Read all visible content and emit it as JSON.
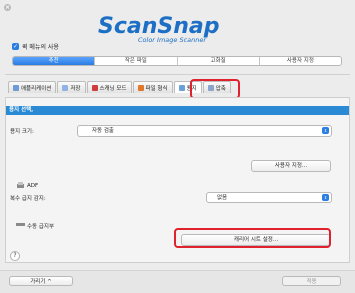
{
  "window": {
    "close_glyph": "×"
  },
  "logo": {
    "brand": "ScanSnap",
    "subtitle": "Color Image Scanner"
  },
  "quick_menu": {
    "checked": true,
    "label": "퀵 메뉴의 사용"
  },
  "profiles": [
    {
      "label": "추천",
      "active": true
    },
    {
      "label": "작은 파일",
      "active": false
    },
    {
      "label": "고화질",
      "active": false
    },
    {
      "label": "사용자 지정",
      "active": false
    }
  ],
  "tabs": [
    {
      "label": "애플리케이션",
      "icon": "application-icon",
      "color": "#6c9bd6"
    },
    {
      "label": "저장",
      "icon": "folder-icon",
      "color": "#8fb4e4"
    },
    {
      "label": "스캐닝 모드",
      "icon": "scan-mode-icon",
      "color": "#d13d3d"
    },
    {
      "label": "파일 형식",
      "icon": "file-format-icon",
      "color": "#e07830"
    },
    {
      "label": "용지",
      "icon": "paper-icon",
      "color": "#6ca0d8",
      "active": true
    },
    {
      "label": "압축",
      "icon": "compression-icon",
      "color": "#8aa5c9"
    }
  ],
  "panel": {
    "section_title": "용지 선택,",
    "paper_size_label": "용지 크기:",
    "paper_size_value": "자동 검출",
    "custom_button": "사용자 지정...",
    "adf_label": "ADF",
    "multifeed_label": "복수 급지 감지:",
    "multifeed_value": "없음",
    "manual_feed_label": "수동 급지부",
    "carrier_button": "캐리어 시트 설정..."
  },
  "help": {
    "glyph": "?"
  },
  "bottom": {
    "hide_label": "가리기",
    "hide_glyph": "^",
    "apply_label": "적용"
  },
  "colors": {
    "accent": "#2a7de1",
    "section": "#2a8ad4",
    "highlight": "#e0212e"
  }
}
